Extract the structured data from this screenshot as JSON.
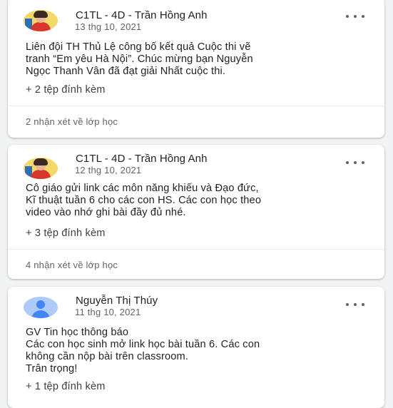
{
  "posts": [
    {
      "author": "C1TL - 4D - Trần Hồng Anh",
      "date": "13 thg 10, 2021",
      "lines": [
        "Liên đội TH Thủ Lệ công bố kết quả Cuộc thi vẽ",
        "tranh “Em yêu Hà Nội”. Chúc mừng bạn Nguyễn",
        "Ngọc Thanh Vân đã đạt giải Nhất cuộc thi."
      ],
      "attachments": "+ 2 tệp đính kèm",
      "comments": "2 nhận xét về lớp học",
      "avatar_icon": "user-photo-icon",
      "more_icon": "more-options-icon"
    },
    {
      "author": "C1TL - 4D - Trần Hồng Anh",
      "date": "12 thg 10, 2021",
      "lines": [
        "Cô giáo gửi link các môn năng khiếu và Đạo đức,",
        "Kĩ thuật tuần 6 cho các con HS. Các con học theo",
        "video vào nhớ ghi bài đầy đủ nhé."
      ],
      "attachments": "+ 3 tệp đính kèm",
      "comments": "4 nhận xét về lớp học",
      "avatar_icon": "user-photo-icon",
      "more_icon": "more-options-icon"
    },
    {
      "author": "Nguyễn Thị Thúy",
      "date": "11 thg 10, 2021",
      "lines": [
        "GV Tin học thông báo",
        "Các con học sinh mở link học bài tuần 6. Các con",
        "không cần nộp bài trên classroom.",
        "Trân trọng!"
      ],
      "attachments": "+ 1 tệp đính kèm",
      "avatar_icon": "default-avatar-icon",
      "more_icon": "more-options-icon"
    }
  ],
  "colors": {
    "background": "#f1f3f4",
    "card": "#ffffff",
    "text_primary": "#202124",
    "text_secondary": "#5f6368",
    "avatar_default": "#4285f4"
  }
}
